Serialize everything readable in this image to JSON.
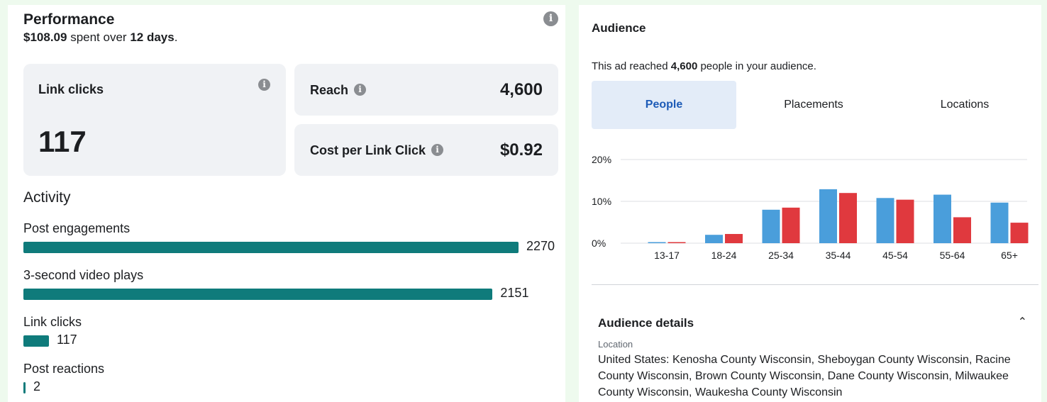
{
  "performance": {
    "title": "Performance",
    "spent": "$108.09",
    "spent_mid": "spent over",
    "days": "12 days",
    "period": ".",
    "cards": {
      "link_clicks": {
        "label": "Link clicks",
        "value": "117"
      },
      "reach": {
        "label": "Reach",
        "value": "4,600"
      },
      "cost_per_link_click": {
        "label": "Cost per Link Click",
        "value": "$0.92"
      }
    }
  },
  "activity": {
    "title": "Activity",
    "max": 2270,
    "items": [
      {
        "label": "Post engagements",
        "value": 2270
      },
      {
        "label": "3-second video plays",
        "value": 2151
      },
      {
        "label": "Link clicks",
        "value": 117
      },
      {
        "label": "Post reactions",
        "value": 2
      }
    ]
  },
  "audience": {
    "title": "Audience",
    "reach_prefix": "This ad reached",
    "reach_count": "4,600",
    "reach_suffix": "people in your audience.",
    "tabs": [
      {
        "label": "People",
        "active": true
      },
      {
        "label": "Placements",
        "active": false
      },
      {
        "label": "Locations",
        "active": false
      }
    ],
    "details": {
      "title": "Audience details",
      "location_label": "Location",
      "location_text": "United States: Kenosha County Wisconsin, Sheboygan County Wisconsin, Racine County Wisconsin, Brown County Wisconsin, Dane County Wisconsin, Milwaukee County Wisconsin, Waukesha County Wisconsin"
    }
  },
  "colors": {
    "activity_bar": "#0f7b7b",
    "series_blue": "#4a9edb",
    "series_red": "#e0393e"
  },
  "chart_data": {
    "type": "bar",
    "categories": [
      "13-17",
      "18-24",
      "25-34",
      "35-44",
      "45-54",
      "55-64",
      "65+"
    ],
    "series": [
      {
        "values": [
          0.2,
          2.0,
          8.0,
          12.9,
          10.8,
          11.6,
          9.7
        ]
      },
      {
        "values": [
          0.2,
          2.2,
          8.5,
          12.0,
          10.4,
          6.2,
          4.9
        ]
      }
    ],
    "ylim": [
      0,
      20
    ],
    "yticks": [
      "0%",
      "10%",
      "20%"
    ],
    "grid": true
  }
}
